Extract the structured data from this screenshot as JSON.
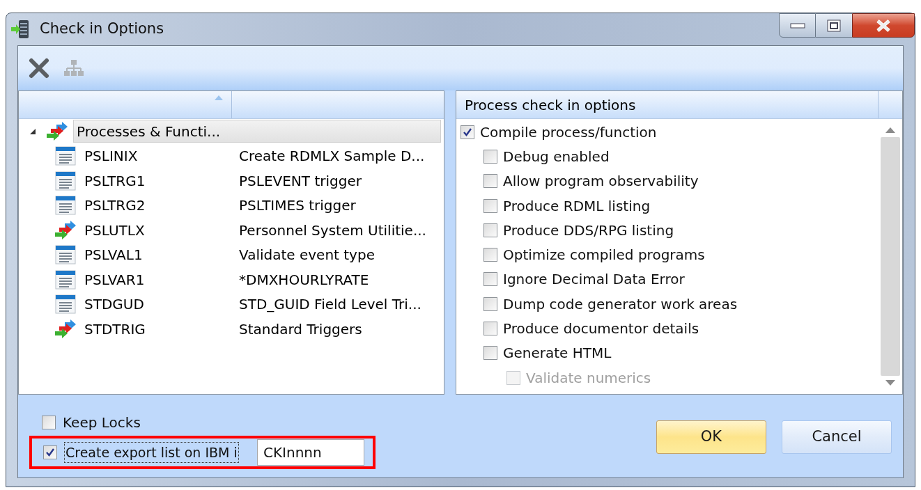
{
  "window": {
    "title": "Check in Options"
  },
  "toolbar": [
    {
      "kind": "delete",
      "disabled": false
    },
    {
      "kind": "hierarchy",
      "disabled": true
    }
  ],
  "tree": {
    "sort_ascending": true,
    "items": [
      {
        "name": "Processes & Functi...",
        "kind": "process",
        "expanded": true,
        "selected": true,
        "children": [
          {
            "name": "PSLINIX",
            "description": "Create RDMLX Sample D...",
            "kind": "list",
            "selected": false
          },
          {
            "name": "PSLTRG1",
            "description": "PSLEVENT trigger",
            "kind": "list",
            "selected": false
          },
          {
            "name": "PSLTRG2",
            "description": "PSLTIMES trigger",
            "kind": "list",
            "selected": false
          },
          {
            "name": "PSLUTLX",
            "description": "Personnel System Utilitie...",
            "kind": "process",
            "selected": false
          },
          {
            "name": "PSLVAL1",
            "description": "Validate event type",
            "kind": "list",
            "selected": false
          },
          {
            "name": "PSLVAR1",
            "description": "*DMXHOURLYRATE",
            "kind": "list",
            "selected": false
          },
          {
            "name": "STDGUD",
            "description": "STD_GUID Field Level Tri...",
            "kind": "list",
            "selected": false
          },
          {
            "name": "STDTRIG",
            "description": "Standard Triggers",
            "kind": "process",
            "selected": false
          }
        ]
      }
    ]
  },
  "options": {
    "header": "Process check in options",
    "items": [
      {
        "label": "Compile process/function",
        "checked": true,
        "disabled": false,
        "children": [
          {
            "label": "Debug enabled",
            "checked": false,
            "disabled": false
          },
          {
            "label": "Allow program observability",
            "checked": false,
            "disabled": false
          },
          {
            "label": "Produce RDML listing",
            "checked": false,
            "disabled": false
          },
          {
            "label": "Produce DDS/RPG listing",
            "checked": false,
            "disabled": false
          },
          {
            "label": "Optimize compiled programs",
            "checked": false,
            "disabled": false
          },
          {
            "label": "Ignore Decimal Data Error",
            "checked": false,
            "disabled": false
          },
          {
            "label": "Dump code generator work areas",
            "checked": false,
            "disabled": false
          },
          {
            "label": "Produce documentor details",
            "checked": false,
            "disabled": false
          },
          {
            "label": "Generate HTML",
            "checked": false,
            "disabled": false,
            "children": [
              {
                "label": "Validate numerics",
                "checked": false,
                "disabled": true
              }
            ]
          }
        ]
      }
    ]
  },
  "keep_locks": {
    "label": "Keep Locks",
    "checked": false
  },
  "export_list": {
    "label": "Create export list on IBM i",
    "checked": true,
    "focused": true,
    "value": "CKInnnn",
    "highlighted": true
  },
  "buttons": [
    {
      "label": "OK",
      "default": true
    },
    {
      "label": "Cancel",
      "default": false
    }
  ]
}
